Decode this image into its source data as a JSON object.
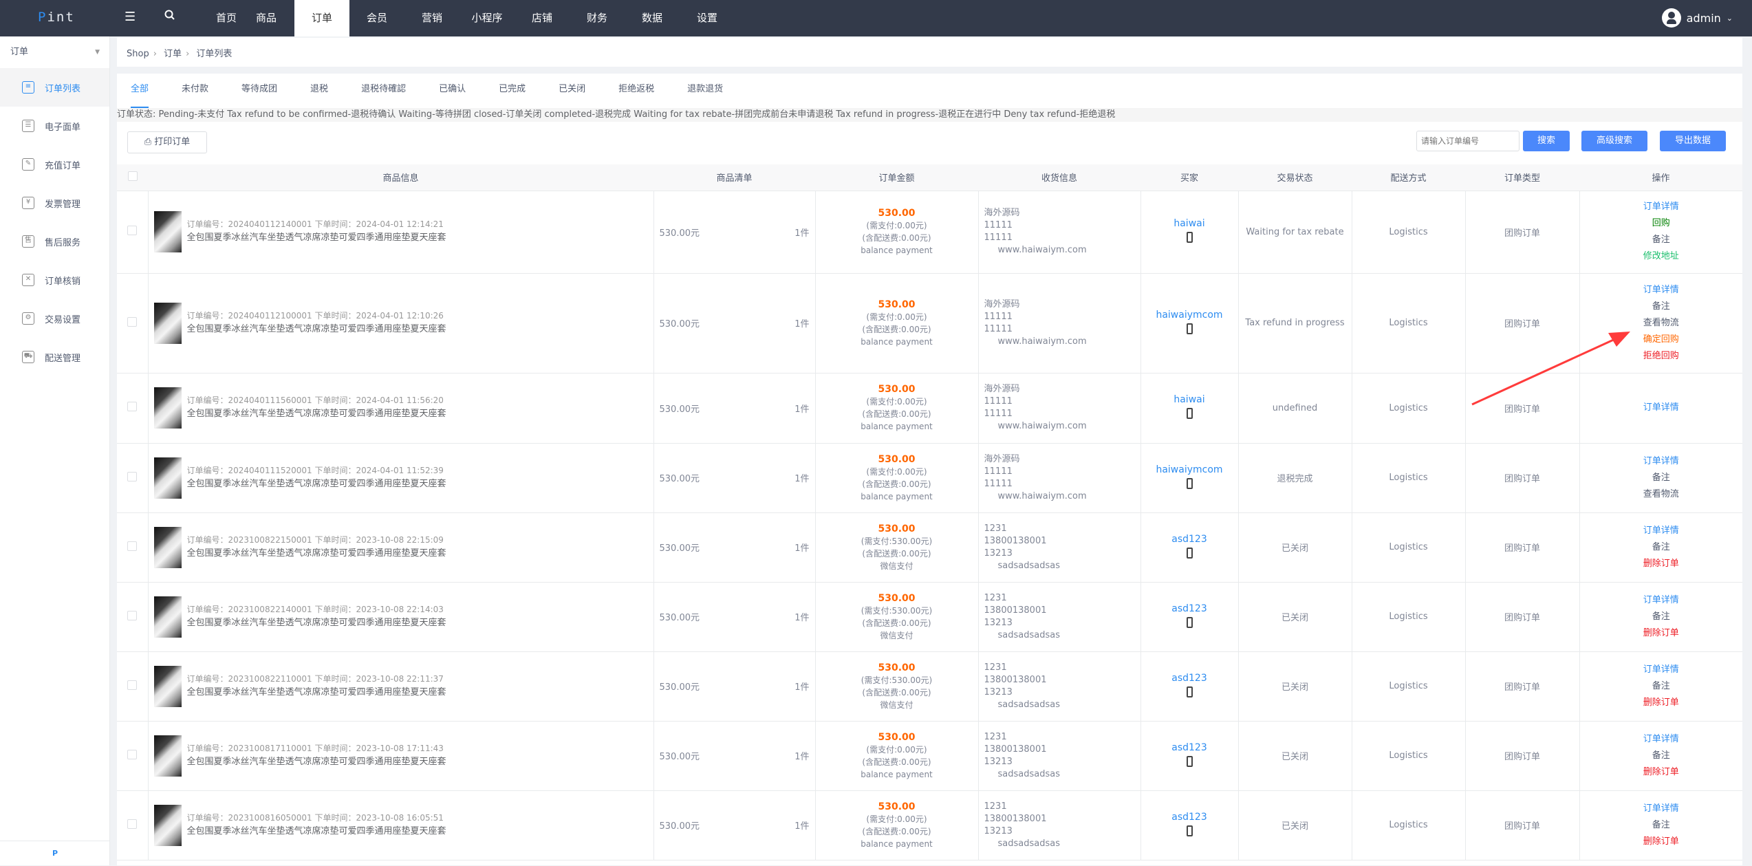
{
  "topbar": {
    "logo_p": "P",
    "logo_rest": "int",
    "menu_icon": "hamburger-icon",
    "search_icon": "search-icon",
    "nav": [
      {
        "label": "首页",
        "active": false
      },
      {
        "label": "商品",
        "active": false
      },
      {
        "label": "订单",
        "active": true
      },
      {
        "label": "会员",
        "active": false
      },
      {
        "label": "营销",
        "active": false
      },
      {
        "label": "小程序",
        "active": false
      },
      {
        "label": "店铺",
        "active": false
      },
      {
        "label": "财务",
        "active": false
      },
      {
        "label": "数据",
        "active": false
      },
      {
        "label": "设置",
        "active": false
      }
    ],
    "user": "admin"
  },
  "sidebar": {
    "header": "订单",
    "items": [
      {
        "label": "订单列表",
        "icon": "document-icon",
        "active": true
      },
      {
        "label": "电子面单",
        "icon": "list-icon",
        "active": false
      },
      {
        "label": "充值订单",
        "icon": "edit-icon",
        "active": false
      },
      {
        "label": "发票管理",
        "icon": "invoice-icon",
        "active": false
      },
      {
        "label": "售后服务",
        "icon": "shield-icon",
        "active": false
      },
      {
        "label": "订单核销",
        "icon": "verify-icon",
        "active": false
      },
      {
        "label": "交易设置",
        "icon": "gear-icon",
        "active": false
      },
      {
        "label": "配送管理",
        "icon": "truck-icon",
        "active": false
      }
    ],
    "footer": "P"
  },
  "breadcrumb": [
    "Shop",
    "订单",
    "订单列表"
  ],
  "tabs": [
    "全部",
    "未付款",
    "等待成团",
    "退税",
    "退税待確認",
    "已确认",
    "已完成",
    "已关闭",
    "拒绝返税",
    "退款退货"
  ],
  "status_note": "订单状态: Pending-未支付 Tax refund to be confirmed-退税待确认 Waiting-等待拼团 closed-订单关闭 completed-退税完成 Waiting for tax rebate-拼团完成前台未申请退税 Tax refund in progress-退税正在进行中 Deny tax refund-拒绝退税",
  "toolbar": {
    "print_label": "打印订单",
    "search_placeholder": "请输入订单编号",
    "search_label": "搜索",
    "advanced_label": "高级搜索",
    "export_label": "导出数据"
  },
  "table": {
    "headers": [
      "商品信息",
      "商品清单",
      "订单金额",
      "收货信息",
      "买家",
      "交易状态",
      "配送方式",
      "订单类型",
      "操作"
    ],
    "rows": [
      {
        "order_no": "订单编号：2024040112140001 下单时间：2024-04-01 12:14:21",
        "product": "全包围夏季冰丝汽车坐垫透气凉席凉垫可爱四季通用座垫夏天座套",
        "price": "530.00元",
        "qty": "1件",
        "amount": "530.00",
        "need_pay": "(需支付:0.00元)",
        "shipping_fee": "(含配送费:0.00元)",
        "pay_method": "balance payment",
        "addr": [
          "海外源码",
          "11111",
          "11111"
        ],
        "addr_detail": "www.haiwaiym.com",
        "buyer": "haiwai",
        "status": "Waiting for tax rebate",
        "delivery": "Logistics",
        "type": "团购订单",
        "actions": [
          {
            "label": "订单详情",
            "color": "blue"
          },
          {
            "label": "回购",
            "color": "dkgreen"
          },
          {
            "label": "备注",
            "color": "gray"
          },
          {
            "label": "修改地址",
            "color": "green"
          }
        ]
      },
      {
        "order_no": "订单编号：2024040112100001 下单时间：2024-04-01 12:10:26",
        "product": "全包围夏季冰丝汽车坐垫透气凉席凉垫可爱四季通用座垫夏天座套",
        "price": "530.00元",
        "qty": "1件",
        "amount": "530.00",
        "need_pay": "(需支付:0.00元)",
        "shipping_fee": "(含配送费:0.00元)",
        "pay_method": "balance payment",
        "addr": [
          "海外源码",
          "11111",
          "11111"
        ],
        "addr_detail": "www.haiwaiym.com",
        "buyer": "haiwaiymcom",
        "status": "Tax refund in progress",
        "delivery": "Logistics",
        "type": "团购订单",
        "actions": [
          {
            "label": "订单详情",
            "color": "blue"
          },
          {
            "label": "备注",
            "color": "gray"
          },
          {
            "label": "查看物流",
            "color": "gray"
          },
          {
            "label": "确定回购",
            "color": "orange"
          },
          {
            "label": "拒绝回购",
            "color": "red"
          }
        ]
      },
      {
        "order_no": "订单编号：2024040111560001 下单时间：2024-04-01 11:56:20",
        "product": "全包围夏季冰丝汽车坐垫透气凉席凉垫可爱四季通用座垫夏天座套",
        "price": "530.00元",
        "qty": "1件",
        "amount": "530.00",
        "need_pay": "(需支付:0.00元)",
        "shipping_fee": "(含配送费:0.00元)",
        "pay_method": "balance payment",
        "addr": [
          "海外源码",
          "11111",
          "11111"
        ],
        "addr_detail": "www.haiwaiym.com",
        "buyer": "haiwai",
        "status": "undefined",
        "delivery": "Logistics",
        "type": "团购订单",
        "actions": [
          {
            "label": "订单详情",
            "color": "blue"
          }
        ]
      },
      {
        "order_no": "订单编号：2024040111520001 下单时间：2024-04-01 11:52:39",
        "product": "全包围夏季冰丝汽车坐垫透气凉席凉垫可爱四季通用座垫夏天座套",
        "price": "530.00元",
        "qty": "1件",
        "amount": "530.00",
        "need_pay": "(需支付:0.00元)",
        "shipping_fee": "(含配送费:0.00元)",
        "pay_method": "balance payment",
        "addr": [
          "海外源码",
          "11111",
          "11111"
        ],
        "addr_detail": "www.haiwaiym.com",
        "buyer": "haiwaiymcom",
        "status": "退税完成",
        "delivery": "Logistics",
        "type": "团购订单",
        "actions": [
          {
            "label": "订单详情",
            "color": "blue"
          },
          {
            "label": "备注",
            "color": "gray"
          },
          {
            "label": "查看物流",
            "color": "gray"
          }
        ]
      },
      {
        "order_no": "订单编号：2023100822150001 下单时间：2023-10-08 22:15:09",
        "product": "全包围夏季冰丝汽车坐垫透气凉席凉垫可爱四季通用座垫夏天座套",
        "price": "530.00元",
        "qty": "1件",
        "amount": "530.00",
        "need_pay": "(需支付:530.00元)",
        "shipping_fee": "(含配送费:0.00元)",
        "pay_method": "微信支付",
        "addr": [
          "1231",
          "13800138001",
          "13213"
        ],
        "addr_detail": "sadsadsadsas",
        "buyer": "asd123",
        "status": "已关闭",
        "delivery": "Logistics",
        "type": "团购订单",
        "actions": [
          {
            "label": "订单详情",
            "color": "blue"
          },
          {
            "label": "备注",
            "color": "gray"
          },
          {
            "label": "删除订单",
            "color": "red"
          }
        ]
      },
      {
        "order_no": "订单编号：2023100822140001 下单时间：2023-10-08 22:14:03",
        "product": "全包围夏季冰丝汽车坐垫透气凉席凉垫可爱四季通用座垫夏天座套",
        "price": "530.00元",
        "qty": "1件",
        "amount": "530.00",
        "need_pay": "(需支付:530.00元)",
        "shipping_fee": "(含配送费:0.00元)",
        "pay_method": "微信支付",
        "addr": [
          "1231",
          "13800138001",
          "13213"
        ],
        "addr_detail": "sadsadsadsas",
        "buyer": "asd123",
        "status": "已关闭",
        "delivery": "Logistics",
        "type": "团购订单",
        "actions": [
          {
            "label": "订单详情",
            "color": "blue"
          },
          {
            "label": "备注",
            "color": "gray"
          },
          {
            "label": "删除订单",
            "color": "red"
          }
        ]
      },
      {
        "order_no": "订单编号：2023100822110001 下单时间：2023-10-08 22:11:37",
        "product": "全包围夏季冰丝汽车坐垫透气凉席凉垫可爱四季通用座垫夏天座套",
        "price": "530.00元",
        "qty": "1件",
        "amount": "530.00",
        "need_pay": "(需支付:530.00元)",
        "shipping_fee": "(含配送费:0.00元)",
        "pay_method": "微信支付",
        "addr": [
          "1231",
          "13800138001",
          "13213"
        ],
        "addr_detail": "sadsadsadsas",
        "buyer": "asd123",
        "status": "已关闭",
        "delivery": "Logistics",
        "type": "团购订单",
        "actions": [
          {
            "label": "订单详情",
            "color": "blue"
          },
          {
            "label": "备注",
            "color": "gray"
          },
          {
            "label": "删除订单",
            "color": "red"
          }
        ]
      },
      {
        "order_no": "订单编号：2023100817110001 下单时间：2023-10-08 17:11:43",
        "product": "全包围夏季冰丝汽车坐垫透气凉席凉垫可爱四季通用座垫夏天座套",
        "price": "530.00元",
        "qty": "1件",
        "amount": "530.00",
        "need_pay": "(需支付:0.00元)",
        "shipping_fee": "(含配送费:0.00元)",
        "pay_method": "balance payment",
        "addr": [
          "1231",
          "13800138001",
          "13213"
        ],
        "addr_detail": "sadsadsadsas",
        "buyer": "asd123",
        "status": "已关闭",
        "delivery": "Logistics",
        "type": "团购订单",
        "actions": [
          {
            "label": "订单详情",
            "color": "blue"
          },
          {
            "label": "备注",
            "color": "gray"
          },
          {
            "label": "删除订单",
            "color": "red"
          }
        ]
      },
      {
        "order_no": "订单编号：2023100816050001 下单时间：2023-10-08 16:05:51",
        "product": "全包围夏季冰丝汽车坐垫透气凉席凉垫可爱四季通用座垫夏天座套",
        "price": "530.00元",
        "qty": "1件",
        "amount": "530.00",
        "need_pay": "(需支付:0.00元)",
        "shipping_fee": "(含配送费:0.00元)",
        "pay_method": "balance payment",
        "addr": [
          "1231",
          "13800138001",
          "13213"
        ],
        "addr_detail": "sadsadsadsas",
        "buyer": "asd123",
        "status": "已关闭",
        "delivery": "Logistics",
        "type": "团购订单",
        "actions": [
          {
            "label": "订单详情",
            "color": "blue"
          },
          {
            "label": "备注",
            "color": "gray"
          },
          {
            "label": "删除订单",
            "color": "red"
          }
        ]
      }
    ]
  },
  "annotation": {
    "type": "red-arrow",
    "points_to": "确定回购",
    "color": "#ff3b3b"
  }
}
